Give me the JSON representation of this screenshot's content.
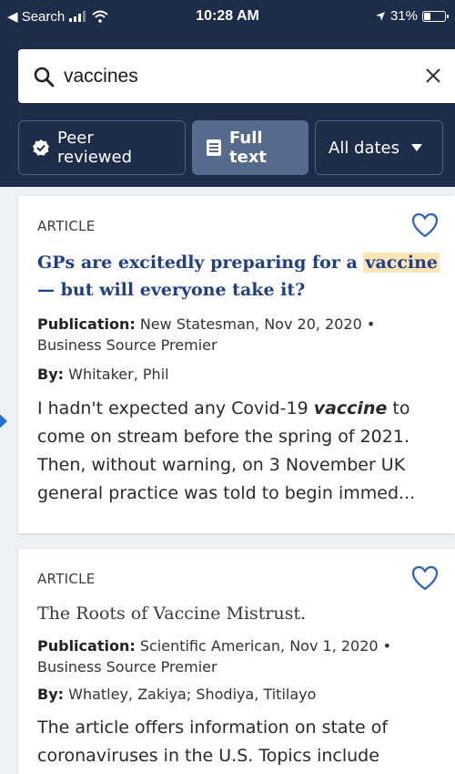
{
  "status_bar": {
    "back_label": "◀ Search",
    "time": "10:28 AM",
    "battery_percent": "31%"
  },
  "search": {
    "query": "vaccines"
  },
  "filters": {
    "peer_reviewed": "Peer reviewed",
    "full_text": "Full text",
    "all_dates": "All dates"
  },
  "results": [
    {
      "type": "ARTICLE",
      "title_before": "GPs are excitedly preparing for a ",
      "title_highlight": "vaccine",
      "title_after": "— but will everyone take it?",
      "publication_label": "Publication:",
      "publication": "New Statesman, Nov 20, 2020 •",
      "database": "Business Source Premier",
      "by_label": "By:",
      "author": "Whitaker, Phil",
      "snippet_before": "I hadn't expected any Covid-19 ",
      "snippet_highlight": "vaccine",
      "snippet_after": " to come on stream before the spring of 2021. Then, without warning, on 3 November UK general practice was told to begin immed..."
    },
    {
      "type": "ARTICLE",
      "title": "The Roots of Vaccine Mistrust.",
      "publication_label": "Publication:",
      "publication": "Scientific American, Nov 1, 2020 •",
      "database": "Business Source Premier",
      "by_label": "By:",
      "author": "Whatley, Zakiya; Shodiya, Titilayo",
      "snippet": "The article offers information on state of coronaviruses in the U.S. Topics include"
    }
  ],
  "colors": {
    "header_bg": "#1c2c49",
    "title_blue": "#1f3f8a",
    "highlight": "#fce5b5",
    "active_chip": "#556a8c"
  }
}
